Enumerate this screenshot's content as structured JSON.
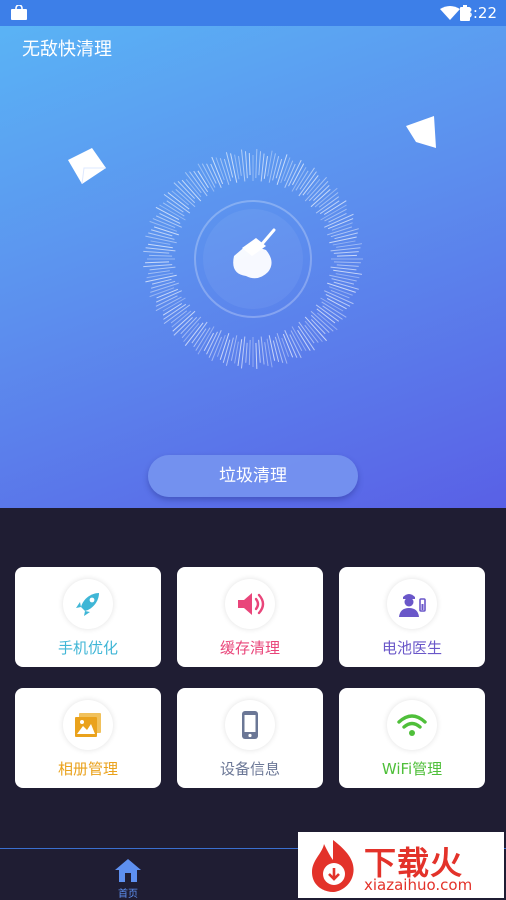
{
  "status_bar": {
    "time": "3:22"
  },
  "app": {
    "title": "无敌快清理"
  },
  "hero": {
    "clean_button": "垃圾清理"
  },
  "features": [
    {
      "label": "手机优化",
      "icon": "rocket-icon",
      "color": "#3fb6d6"
    },
    {
      "label": "缓存清理",
      "icon": "speaker-icon",
      "color": "#e9457a"
    },
    {
      "label": "电池医生",
      "icon": "doctor-icon",
      "color": "#6a57c9"
    },
    {
      "label": "相册管理",
      "icon": "photo-icon",
      "color": "#eaa21c"
    },
    {
      "label": "设备信息",
      "icon": "phone-icon",
      "color": "#6b7796"
    },
    {
      "label": "WiFi管理",
      "icon": "wifi-icon",
      "color": "#4fbf3a"
    }
  ],
  "tabbar": {
    "home_label": "首页"
  },
  "watermark": {
    "brand": "下载火",
    "url": "xiazaihuo.com"
  }
}
